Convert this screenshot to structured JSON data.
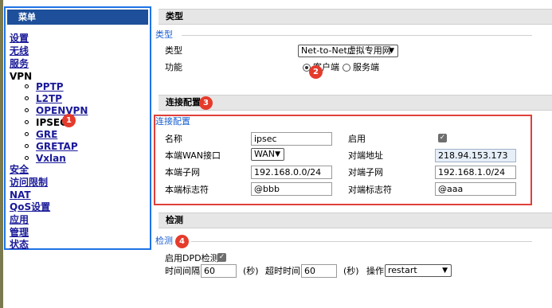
{
  "colors": {
    "accent": "#1e73e6",
    "marker": "#e53b2c",
    "menu_header_bg": "#1d4f9a",
    "link": "#1a1a9a"
  },
  "sidebar": {
    "header": "菜单",
    "items": [
      "设置",
      "无线",
      "服务",
      "VPN"
    ],
    "vpn_sub": [
      "PPTP",
      "L2TP",
      "OPENVPN",
      "IPSEC",
      "GRE",
      "GRETAP",
      "Vxlan"
    ],
    "items_after": [
      "安全",
      "访问限制",
      "NAT",
      "QoS设置",
      "应用",
      "管理",
      "状态"
    ]
  },
  "markers": [
    "1",
    "2",
    "3",
    "4"
  ],
  "type_section": {
    "header": "类型",
    "legend": "类型",
    "type_label": "类型",
    "type_value": "Net-to-Net虚拟专用网",
    "function_label": "功能",
    "radio_client": "客户端",
    "radio_server": "服务端",
    "selected": "客户端"
  },
  "conn_section": {
    "header": "连接配置",
    "legend": "连接配置",
    "name_label": "名称",
    "name_value": "ipsec",
    "enable_label": "启用",
    "enable_checked": true,
    "wan_label": "本端WAN接口",
    "wan_value": "WAN",
    "remote_addr_label": "对端地址",
    "remote_addr_value": "218.94.153.173",
    "local_subnet_label": "本端子网",
    "local_subnet_value": "192.168.0.0/24",
    "remote_subnet_label": "对端子网",
    "remote_subnet_value": "192.168.1.0/24",
    "local_id_label": "本端标志符",
    "local_id_value": "@bbb",
    "remote_id_label": "对端标志符",
    "remote_id_value": "@aaa"
  },
  "detect_section": {
    "header": "检测",
    "legend": "检测",
    "dpd_label": "启用DPD检测",
    "dpd_checked": true,
    "interval_label": "时间间隔",
    "interval_value": "60",
    "interval_unit": "(秒)",
    "timeout_label": "超时时间",
    "timeout_value": "60",
    "timeout_unit": "(秒)",
    "action_label": "操作",
    "action_value": "restart"
  }
}
